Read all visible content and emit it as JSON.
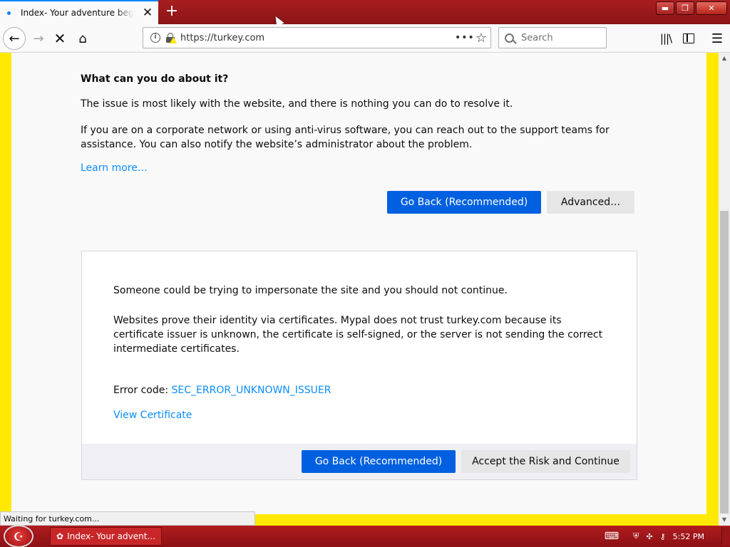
{
  "tab": {
    "title": "Index- Your adventure begins h",
    "close_glyph": "✕"
  },
  "newtab_glyph": "+",
  "window": {
    "min": "▬",
    "max": "❐",
    "close": "✕"
  },
  "nav": {
    "back": "←",
    "forward": "→",
    "stop": "✕",
    "home": "⌂",
    "url": "https://turkey.com",
    "more": "•••",
    "star": "☆",
    "search_placeholder": "Search",
    "library": "|||\\",
    "menu": "☰"
  },
  "page": {
    "heading": "What can you do about it?",
    "p1": "The issue is most likely with the website, and there is nothing you can do to resolve it.",
    "p2": "If you are on a corporate network or using anti-virus software, you can reach out to the support teams for assistance. You can also notify the website’s administrator about the problem.",
    "learn_more": "Learn more…",
    "go_back": "Go Back (Recommended)",
    "advanced": "Advanced…"
  },
  "advanced": {
    "p1": "Someone could be trying to impersonate the site and you should not continue.",
    "p2": "Websites prove their identity via certificates. Mypal does not trust turkey.com because its certificate issuer is unknown, the certificate is self-signed, or the server is not sending the correct intermediate certificates.",
    "error_label": "Error code: ",
    "error_code": "SEC_ERROR_UNKNOWN_ISSUER",
    "view_certificate": "View Certificate",
    "go_back": "Go Back (Recommended)",
    "accept": "Accept the Risk and Continue"
  },
  "status": "Waiting for turkey.com...",
  "taskbar": {
    "start_glyph": "☪",
    "item": "Index- Your advent...",
    "clock": "5:52 PM"
  },
  "colors": {
    "accent": "#0060df",
    "link": "#0a8dff",
    "frame": "#ffe900",
    "titlebar": "#a81e20"
  }
}
